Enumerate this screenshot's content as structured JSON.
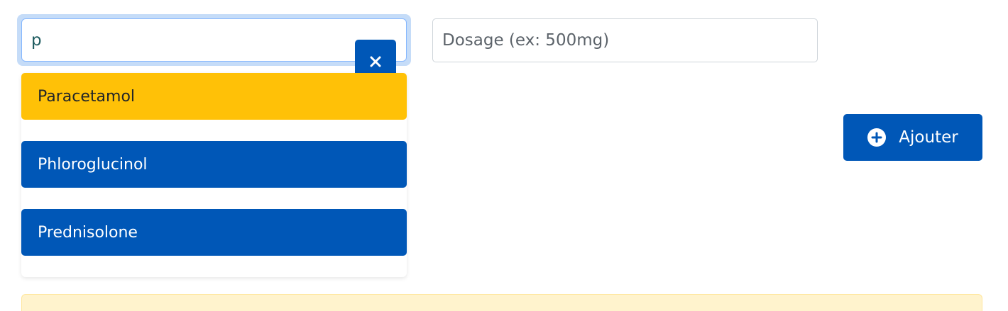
{
  "search": {
    "value": "p",
    "clear_icon": "close-icon"
  },
  "dosage": {
    "placeholder": "Dosage (ex: 500mg)",
    "value": ""
  },
  "suggestions": [
    {
      "label": "Paracetamol",
      "highlighted": true
    },
    {
      "label": "Phloroglucinol",
      "highlighted": false
    },
    {
      "label": "Prednisolone",
      "highlighted": false
    }
  ],
  "add_button": {
    "label": "Ajouter",
    "icon": "plus-circle-icon"
  },
  "colors": {
    "primary": "#0057b7",
    "highlight": "#ffc107",
    "focus_ring": "#c5dcf8",
    "alert_bg": "#fff3cd"
  }
}
